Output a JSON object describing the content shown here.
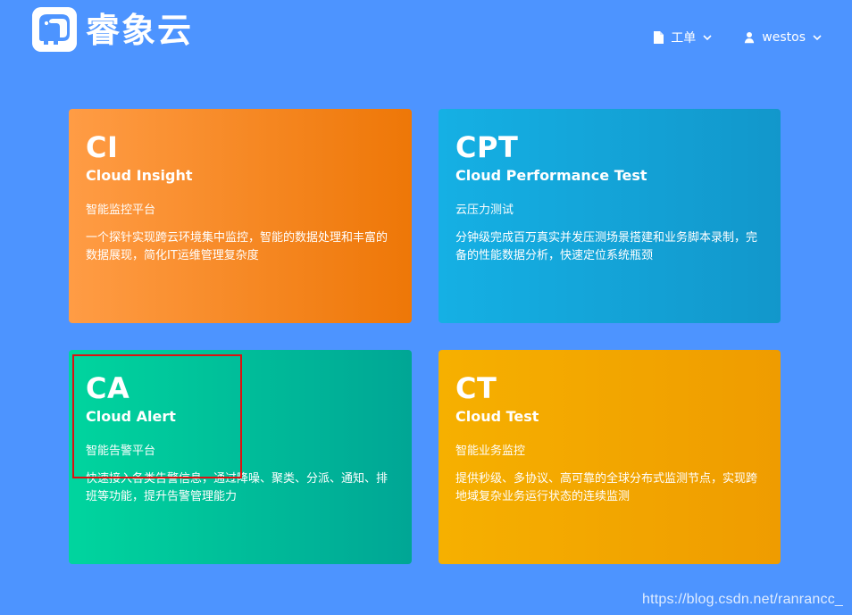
{
  "header": {
    "logo_text": "睿象云",
    "logo_icon": "elephant-logo-icon"
  },
  "nav": {
    "workorder_label": "工单",
    "workorder_icon": "document-icon",
    "workorder_caret_icon": "chevron-down-icon",
    "user_label": "westos",
    "user_icon": "user-icon",
    "user_caret_icon": "chevron-down-icon"
  },
  "cards": [
    {
      "code": "CI",
      "name": "Cloud Insight",
      "subtitle": "智能监控平台",
      "description": "一个探针实现跨云环境集中监控，智能的数据处理和丰富的数据展现，简化IT运维管理复杂度",
      "color_start": "#ff9c45",
      "color_end": "#ee7707"
    },
    {
      "code": "CPT",
      "name": "Cloud Performance Test",
      "subtitle": "云压力测试",
      "description": "分钟级完成百万真实并发压测场景搭建和业务脚本录制，完备的性能数据分析，快速定位系统瓶颈",
      "color_start": "#15b0e4",
      "color_end": "#1297cb"
    },
    {
      "code": "CA",
      "name": "Cloud Alert",
      "subtitle": "智能告警平台",
      "description": "快速接入各类告警信息，通过降噪、聚类、分派、通知、排班等功能，提升告警管理能力",
      "color_start": "#00d59e",
      "color_end": "#00a695"
    },
    {
      "code": "CT",
      "name": "Cloud Test",
      "subtitle": "智能业务监控",
      "description": "提供秒级、多协议、高可靠的全球分布式监测节点，实现跨地域复杂业务运行状态的连续监测",
      "color_start": "#f6b000",
      "color_end": "#ef9c00"
    }
  ],
  "watermark": "https://blog.csdn.net/ranrancc_",
  "page_background": "#4d94ff",
  "highlight_color": "#dd1111"
}
